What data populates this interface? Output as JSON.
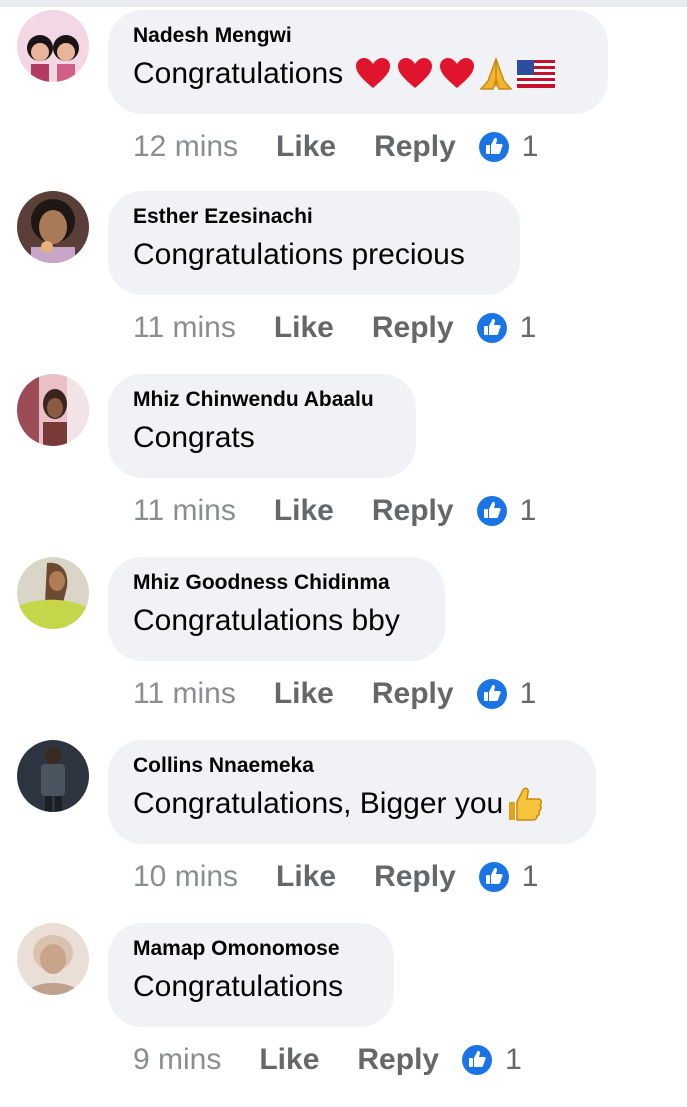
{
  "comments": [
    {
      "author": "Nadesh Mengwi",
      "text": "Congratulations",
      "emojis": [
        "red-heart",
        "red-heart",
        "red-heart",
        "folded-hands",
        "us-flag"
      ],
      "time": "12 mins",
      "like_label": "Like",
      "reply_label": "Reply",
      "reactions": "1",
      "avatar_colors": [
        "#f3d7e4",
        "#b23a63"
      ]
    },
    {
      "author": "Esther Ezesinachi",
      "text": "Congratulations precious",
      "emojis": [],
      "time": "11 mins",
      "like_label": "Like",
      "reply_label": "Reply",
      "reactions": "1",
      "avatar_colors": [
        "#3b2a24",
        "#a87a57"
      ]
    },
    {
      "author": "Mhiz Chinwendu Abaalu",
      "text": "Congrats",
      "emojis": [],
      "time": "11 mins",
      "like_label": "Like",
      "reply_label": "Reply",
      "reactions": "1",
      "avatar_colors": [
        "#e9c0c6",
        "#7a3a38"
      ]
    },
    {
      "author": "Mhiz Goodness Chidinma",
      "text": "Congratulations bby",
      "emojis": [],
      "time": "11 mins",
      "like_label": "Like",
      "reply_label": "Reply",
      "reactions": "1",
      "avatar_colors": [
        "#c6d64a",
        "#6b4a2f"
      ]
    },
    {
      "author": "Collins Nnaemeka",
      "text": "Congratulations, Bigger you",
      "emojis": [
        "thumbs-up"
      ],
      "time": "10 mins",
      "like_label": "Like",
      "reply_label": "Reply",
      "reactions": "1",
      "avatar_colors": [
        "#4a5560",
        "#1a1f26"
      ]
    },
    {
      "author": "Mamap Omonomose",
      "text": "Congratulations",
      "emojis": [],
      "time": "9 mins",
      "like_label": "Like",
      "reply_label": "Reply",
      "reactions": "1",
      "avatar_colors": [
        "#eadfd6",
        "#c9a48b"
      ]
    }
  ],
  "colors": {
    "bubble": "#f0f2f5",
    "like_reaction_blue": "#1b74e4",
    "action_gray": "#65676b",
    "time_gray": "#8a8d91"
  },
  "icons": {
    "reaction": "like-reaction-icon",
    "heart": "red-heart-emoji",
    "hands": "folded-hands-emoji",
    "flag": "us-flag-emoji",
    "thumbs": "thumbs-up-emoji"
  }
}
